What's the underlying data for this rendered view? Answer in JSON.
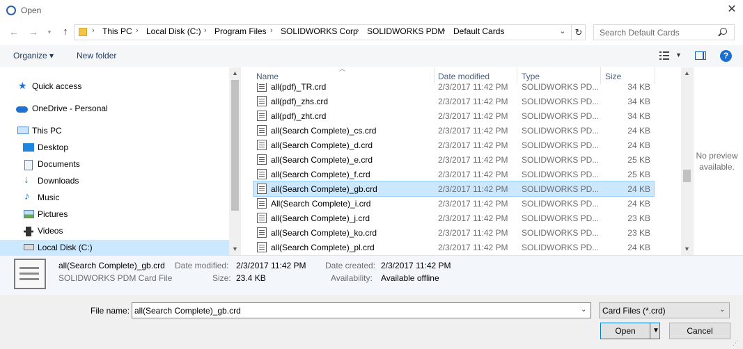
{
  "window": {
    "title": "Open"
  },
  "address": {
    "crumbs": [
      "This PC",
      "Local Disk (C:)",
      "Program Files",
      "SOLIDWORKS Corp",
      "SOLIDWORKS PDM",
      "Default Cards"
    ],
    "separator": "›"
  },
  "search": {
    "placeholder": "Search Default Cards"
  },
  "toolbar": {
    "organize": "Organize ▾",
    "new_folder": "New folder",
    "help": "?"
  },
  "nav": {
    "items": [
      {
        "label": "Quick access",
        "icon": "star-icon"
      },
      {
        "label": "OneDrive - Personal",
        "icon": "cloud-icon"
      },
      {
        "label": "This PC",
        "icon": "computer-icon"
      },
      {
        "label": "Desktop",
        "icon": "desktop-icon"
      },
      {
        "label": "Documents",
        "icon": "documents-icon"
      },
      {
        "label": "Downloads",
        "icon": "download-icon"
      },
      {
        "label": "Music",
        "icon": "music-icon"
      },
      {
        "label": "Pictures",
        "icon": "pictures-icon"
      },
      {
        "label": "Videos",
        "icon": "videos-icon"
      },
      {
        "label": "Local Disk (C:)",
        "icon": "drive-icon"
      }
    ]
  },
  "columns": {
    "name": "Name",
    "date": "Date modified",
    "type": "Type",
    "size": "Size"
  },
  "files": [
    {
      "name": "all(pdf)_TR.crd",
      "date": "2/3/2017 11:42 PM",
      "type": "SOLIDWORKS PD...",
      "size": "34 KB"
    },
    {
      "name": "all(pdf)_zhs.crd",
      "date": "2/3/2017 11:42 PM",
      "type": "SOLIDWORKS PD...",
      "size": "34 KB"
    },
    {
      "name": "all(pdf)_zht.crd",
      "date": "2/3/2017 11:42 PM",
      "type": "SOLIDWORKS PD...",
      "size": "34 KB"
    },
    {
      "name": "all(Search Complete)_cs.crd",
      "date": "2/3/2017 11:42 PM",
      "type": "SOLIDWORKS PD...",
      "size": "24 KB"
    },
    {
      "name": "all(Search Complete)_d.crd",
      "date": "2/3/2017 11:42 PM",
      "type": "SOLIDWORKS PD...",
      "size": "24 KB"
    },
    {
      "name": "all(Search Complete)_e.crd",
      "date": "2/3/2017 11:42 PM",
      "type": "SOLIDWORKS PD...",
      "size": "25 KB"
    },
    {
      "name": "all(Search Complete)_f.crd",
      "date": "2/3/2017 11:42 PM",
      "type": "SOLIDWORKS PD...",
      "size": "25 KB"
    },
    {
      "name": "all(Search Complete)_gb.crd",
      "date": "2/3/2017 11:42 PM",
      "type": "SOLIDWORKS PD...",
      "size": "24 KB"
    },
    {
      "name": "All(Search Complete)_i.crd",
      "date": "2/3/2017 11:42 PM",
      "type": "SOLIDWORKS PD...",
      "size": "24 KB"
    },
    {
      "name": "all(Search Complete)_j.crd",
      "date": "2/3/2017 11:42 PM",
      "type": "SOLIDWORKS PD...",
      "size": "23 KB"
    },
    {
      "name": "all(Search Complete)_ko.crd",
      "date": "2/3/2017 11:42 PM",
      "type": "SOLIDWORKS PD...",
      "size": "23 KB"
    },
    {
      "name": "all(Search Complete)_pl.crd",
      "date": "2/3/2017 11:42 PM",
      "type": "SOLIDWORKS PD...",
      "size": "24 KB"
    }
  ],
  "selected_file_index": 7,
  "preview": {
    "text": "No preview available."
  },
  "details": {
    "name": "all(Search Complete)_gb.crd",
    "kind": "SOLIDWORKS PDM Card File",
    "date_modified_label": "Date modified:",
    "date_modified": "2/3/2017 11:42 PM",
    "size_label": "Size:",
    "size": "23.4 KB",
    "date_created_label": "Date created:",
    "date_created": "2/3/2017 11:42 PM",
    "availability_label": "Availability:",
    "availability": "Available offline"
  },
  "bottom": {
    "file_name_label": "File name:",
    "file_name_value": "all(Search Complete)_gb.crd",
    "filter": "Card Files (*.crd)",
    "open_label": "Open",
    "cancel_label": "Cancel"
  },
  "colors": {
    "selection": "#cce8ff",
    "accent": "#0078d7",
    "help": "#1a6fd2"
  }
}
